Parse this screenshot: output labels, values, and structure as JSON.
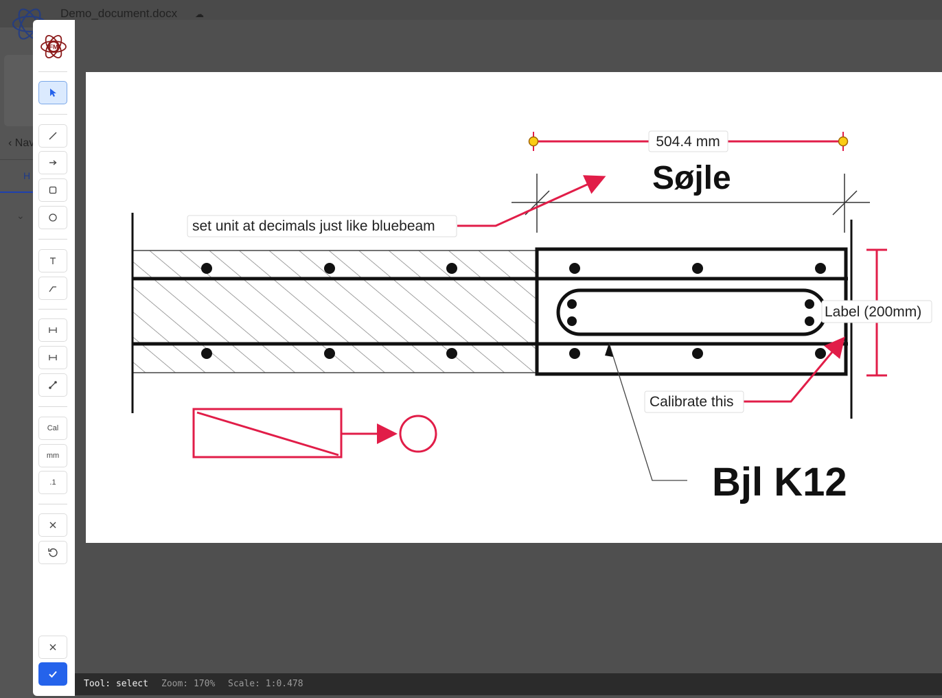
{
  "app": {
    "document_title": "Demo_document.docx",
    "nav_label": "‹ Nav",
    "tab_label": "H"
  },
  "toolbar": {
    "tools": [
      {
        "name": "select",
        "icon": "cursor-icon",
        "active": true
      },
      {
        "name": "line",
        "icon": "line-icon"
      },
      {
        "name": "arrow",
        "icon": "arrow-icon"
      },
      {
        "name": "rectangle",
        "icon": "square-icon"
      },
      {
        "name": "circle",
        "icon": "circle-icon"
      },
      {
        "name": "text",
        "icon": "text-icon"
      },
      {
        "name": "leader",
        "icon": "leader-icon"
      },
      {
        "name": "dimension",
        "icon": "dimension-icon"
      },
      {
        "name": "dimension-2",
        "icon": "dimension-icon"
      },
      {
        "name": "measure",
        "icon": "measure-icon"
      }
    ],
    "cal_label": "Cal",
    "unit_label": "mm",
    "decimals_label": ".1",
    "accent": "#2563eb"
  },
  "drawing": {
    "measure_label": "504.4 mm",
    "title_text": "Søjle",
    "note_text": "set unit at decimals just like bluebeam",
    "label_text": "Label (200mm)",
    "calibrate_text": "Calibrate this",
    "rebar_text": "Bjl K12",
    "annotation_color": "#e11d48",
    "handle_color": "#facc15"
  },
  "status": {
    "tool": "Tool: select",
    "zoom": "Zoom: 170%",
    "scale": "Scale: 1:0.478"
  }
}
